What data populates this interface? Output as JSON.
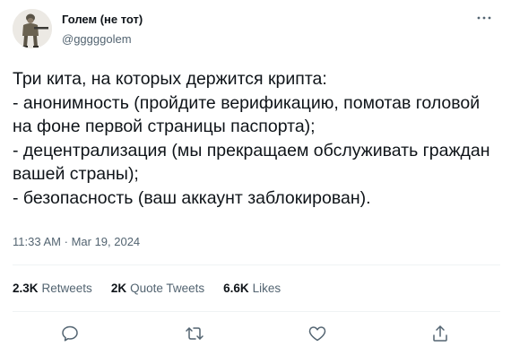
{
  "author": {
    "display_name": "Голем (не тот)",
    "handle": "@gggggolem"
  },
  "tweet": {
    "text": "Три кита, на которых держится крипта:\n- анонимность (пройдите верификацию, помотав головой на фоне первой страницы паспорта);\n- децентрализация (мы прекращаем обслуживать граждан вашей страны);\n- безопасность (ваш аккаунт заблокирован).",
    "time": "11:33 AM",
    "separator": "·",
    "date": "Mar 19, 2024"
  },
  "stats": {
    "retweets_value": "2.3K",
    "retweets_label": "Retweets",
    "quotes_value": "2K",
    "quotes_label": "Quote Tweets",
    "likes_value": "6.6K",
    "likes_label": "Likes"
  },
  "icons": {
    "more": "more-icon",
    "reply": "reply-icon",
    "retweet": "retweet-icon",
    "like": "heart-icon",
    "share": "share-icon"
  },
  "colors": {
    "text": "#0f1419",
    "secondary": "#536471",
    "divider": "#eff3f4"
  }
}
